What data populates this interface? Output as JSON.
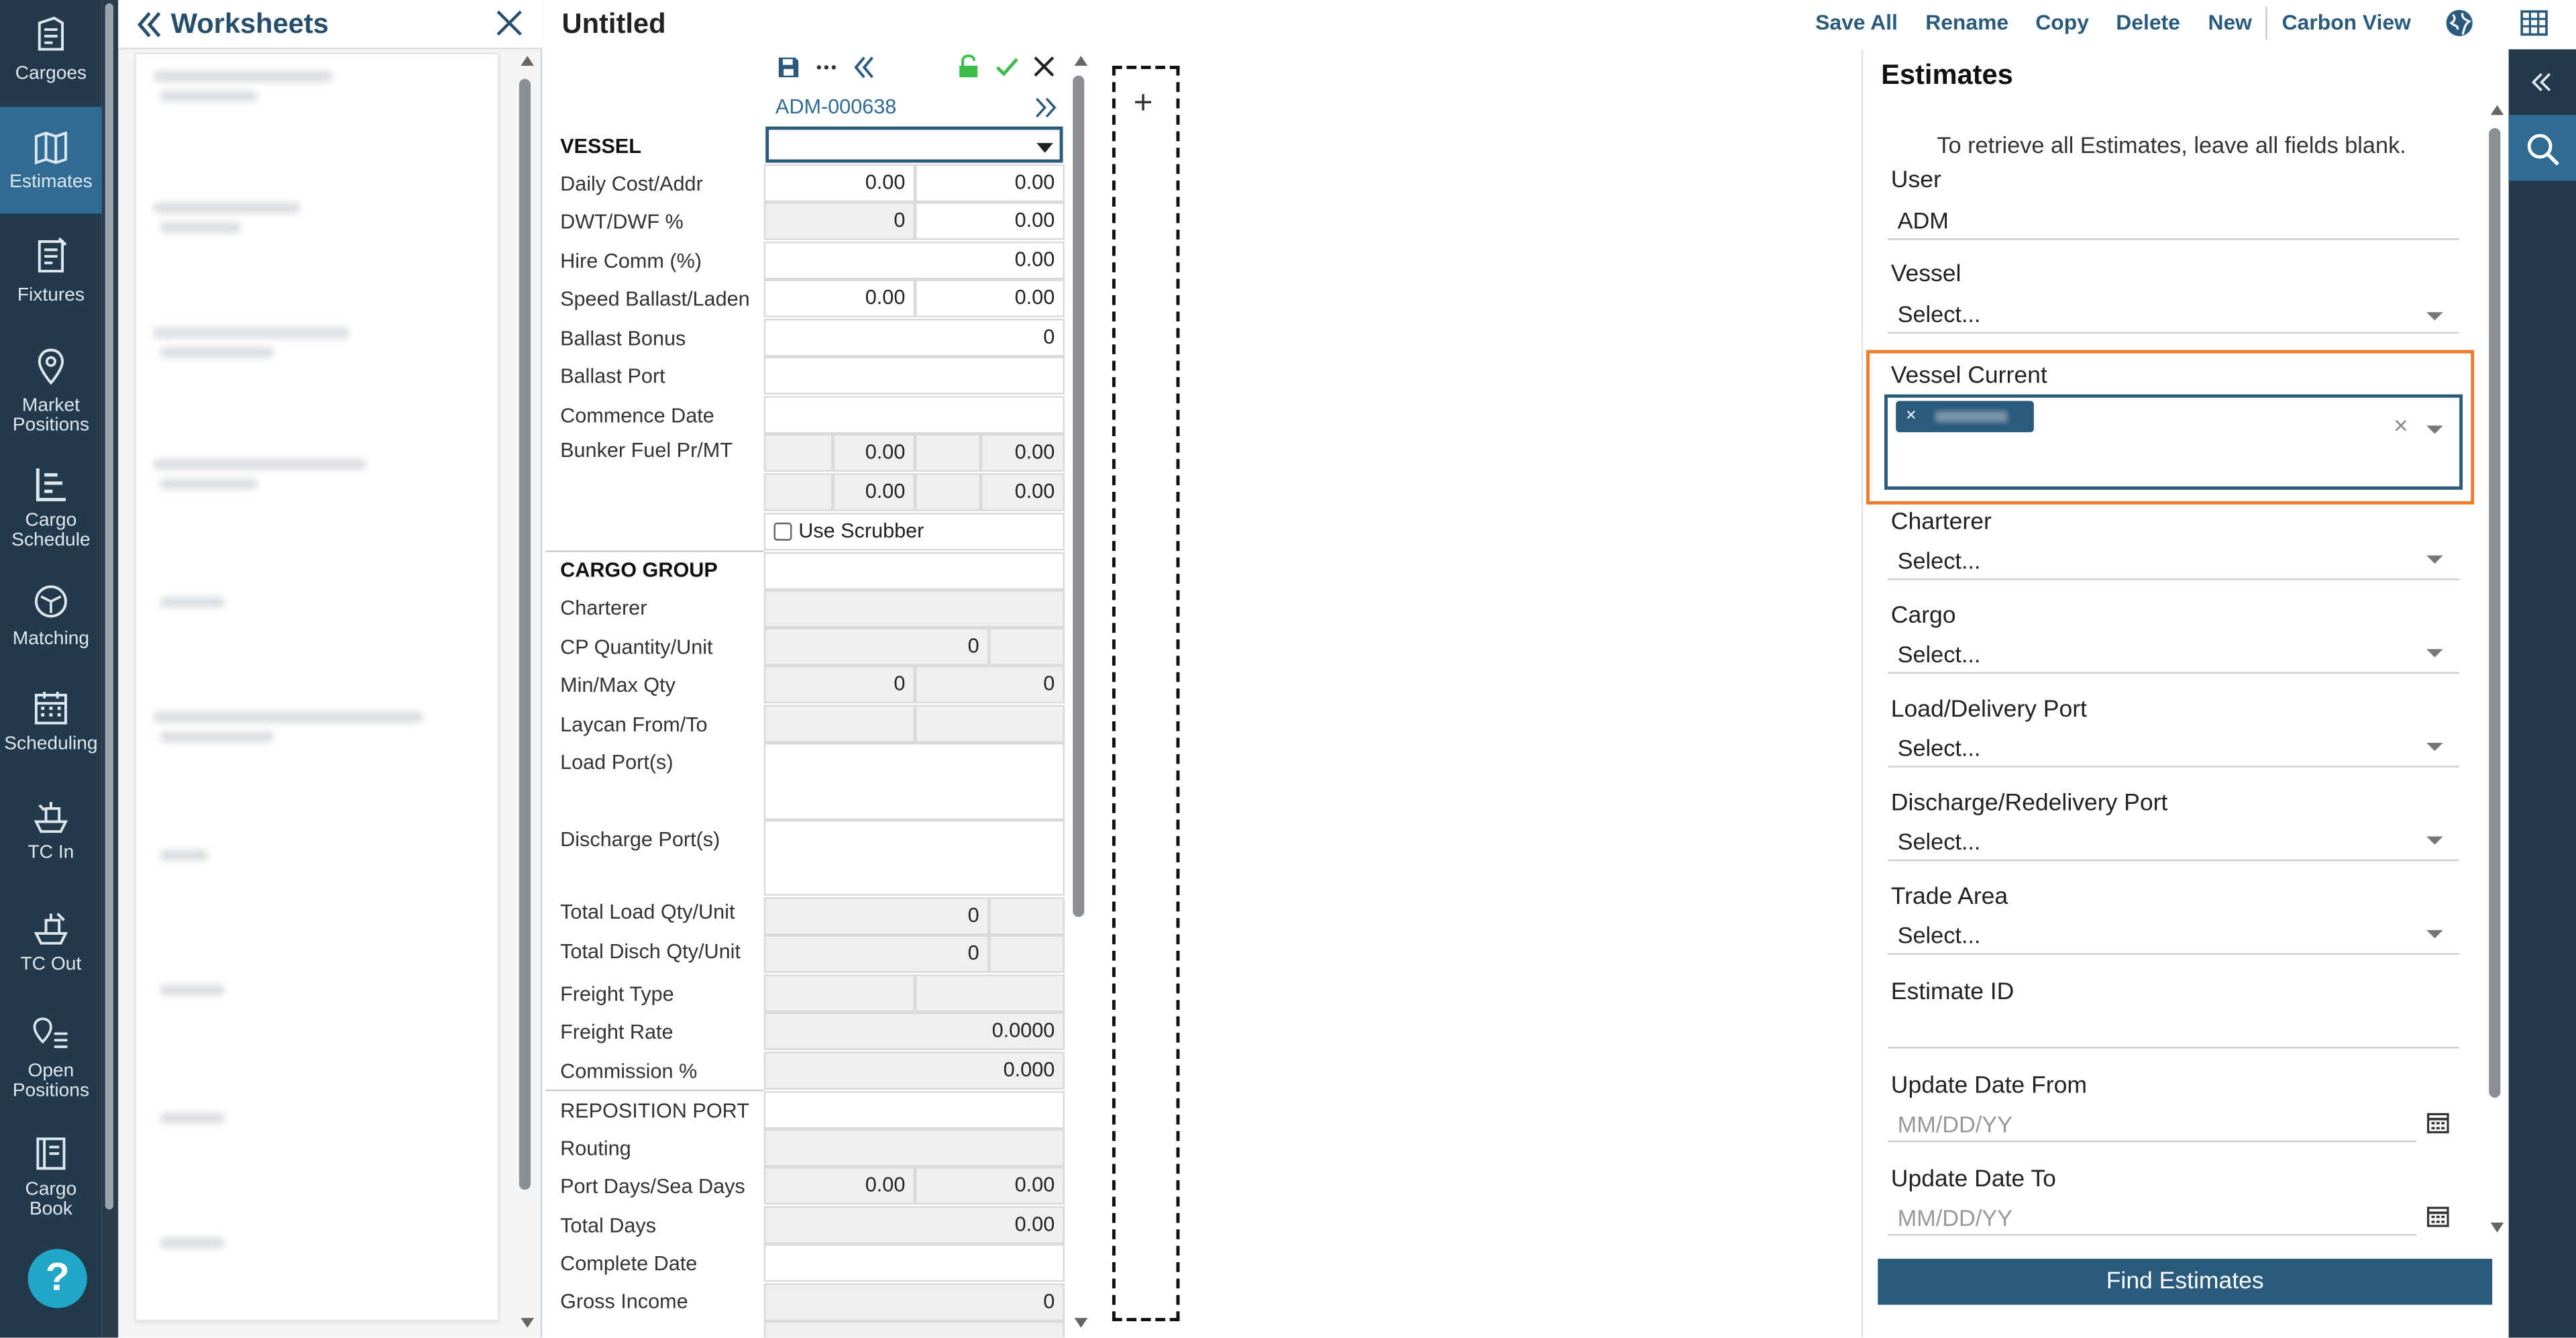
{
  "nav": {
    "items": [
      {
        "label": "Cargoes",
        "icon": "cargoes-icon"
      },
      {
        "label": "Estimates",
        "icon": "map-icon"
      },
      {
        "label": "Fixtures",
        "icon": "fixtures-icon"
      },
      {
        "label1": "Market",
        "label2": "Positions",
        "icon": "location-pin-icon"
      },
      {
        "label1": "Cargo",
        "label2": "Schedule",
        "icon": "cargo-schedule-icon"
      },
      {
        "label": "Matching",
        "icon": "matching-icon"
      },
      {
        "label": "Scheduling",
        "icon": "calendar-icon"
      },
      {
        "label": "TC In",
        "icon": "tc-in-icon"
      },
      {
        "label": "TC Out",
        "icon": "tc-out-icon"
      },
      {
        "label1": "Open",
        "label2": "Positions",
        "icon": "open-positions-icon"
      },
      {
        "label1": "Cargo",
        "label2": "Book",
        "icon": "book-icon"
      }
    ],
    "help": "?"
  },
  "worksheets": {
    "title": "Worksheets"
  },
  "estimate": {
    "title": "Untitled",
    "id": "ADM-000638",
    "labels": {
      "vessel": "VESSEL",
      "daily_cost": "Daily Cost/Addr",
      "dwt": "DWT/DWF %",
      "hire_comm": "Hire Comm (%)",
      "speed": "Speed Ballast/Laden",
      "ballast_bonus": "Ballast Bonus",
      "ballast_port": "Ballast Port",
      "commence_date": "Commence Date",
      "bunker_fuel": "Bunker Fuel Pr/MT",
      "cargo_group": "CARGO GROUP",
      "charterer": "Charterer",
      "cp_qty": "CP Quantity/Unit",
      "min_max": "Min/Max Qty",
      "laycan": "Laycan From/To",
      "load_ports": "Load Port(s)",
      "discharge_ports": "Discharge Port(s)",
      "total_load": "Total Load Qty/Unit",
      "total_disch": "Total Disch Qty/Unit",
      "freight_type": "Freight Type",
      "freight_rate": "Freight Rate",
      "commission": "Commission %",
      "reposition_port": "REPOSITION PORT",
      "routing": "Routing",
      "port_days": "Port Days/Sea Days",
      "total_days": "Total Days",
      "complete_date": "Complete Date",
      "gross_income": "Gross Income"
    },
    "values": {
      "daily_cost_a": "0.00",
      "daily_cost_b": "0.00",
      "dwt_a": "0",
      "dwt_b": "0.00",
      "hire_comm": "0.00",
      "speed_a": "0.00",
      "speed_b": "0.00",
      "ballast_bonus": "0",
      "bunker1_a": "0.00",
      "bunker1_b": "0.00",
      "bunker2_a": "0.00",
      "bunker2_b": "0.00",
      "use_scrubber": "Use Scrubber",
      "cp_qty": "0",
      "min_qty": "0",
      "max_qty": "0",
      "total_load": "0",
      "total_disch": "0",
      "freight_rate": "0.0000",
      "commission": "0.000",
      "port_days": "0.00",
      "sea_days": "0.00",
      "total_days": "0.00",
      "gross_income": "0"
    }
  },
  "actions": {
    "save_all": "Save All",
    "rename": "Rename",
    "copy": "Copy",
    "delete": "Delete",
    "new": "New",
    "carbon_view": "Carbon View"
  },
  "search": {
    "title": "Estimates",
    "hint": "To retrieve all Estimates, leave all fields blank.",
    "user_label": "User",
    "user_value": "ADM",
    "vessel_label": "Vessel",
    "vessel_current_label": "Vessel Current",
    "charterer_label": "Charterer",
    "cargo_label": "Cargo",
    "load_port_label": "Load/Delivery Port",
    "discharge_port_label": "Discharge/Redelivery Port",
    "trade_area_label": "Trade Area",
    "estimate_id_label": "Estimate ID",
    "update_from_label": "Update Date From",
    "update_to_label": "Update Date To",
    "select_placeholder": "Select...",
    "date_placeholder": "MM/DD/YY",
    "chip_x": "×",
    "clear_x": "×",
    "find_button": "Find Estimates"
  },
  "colors": {
    "nav_bg": "#233a4c",
    "accent": "#2a5a7c",
    "highlight": "#f07b2a",
    "active": "#2f6b92"
  }
}
